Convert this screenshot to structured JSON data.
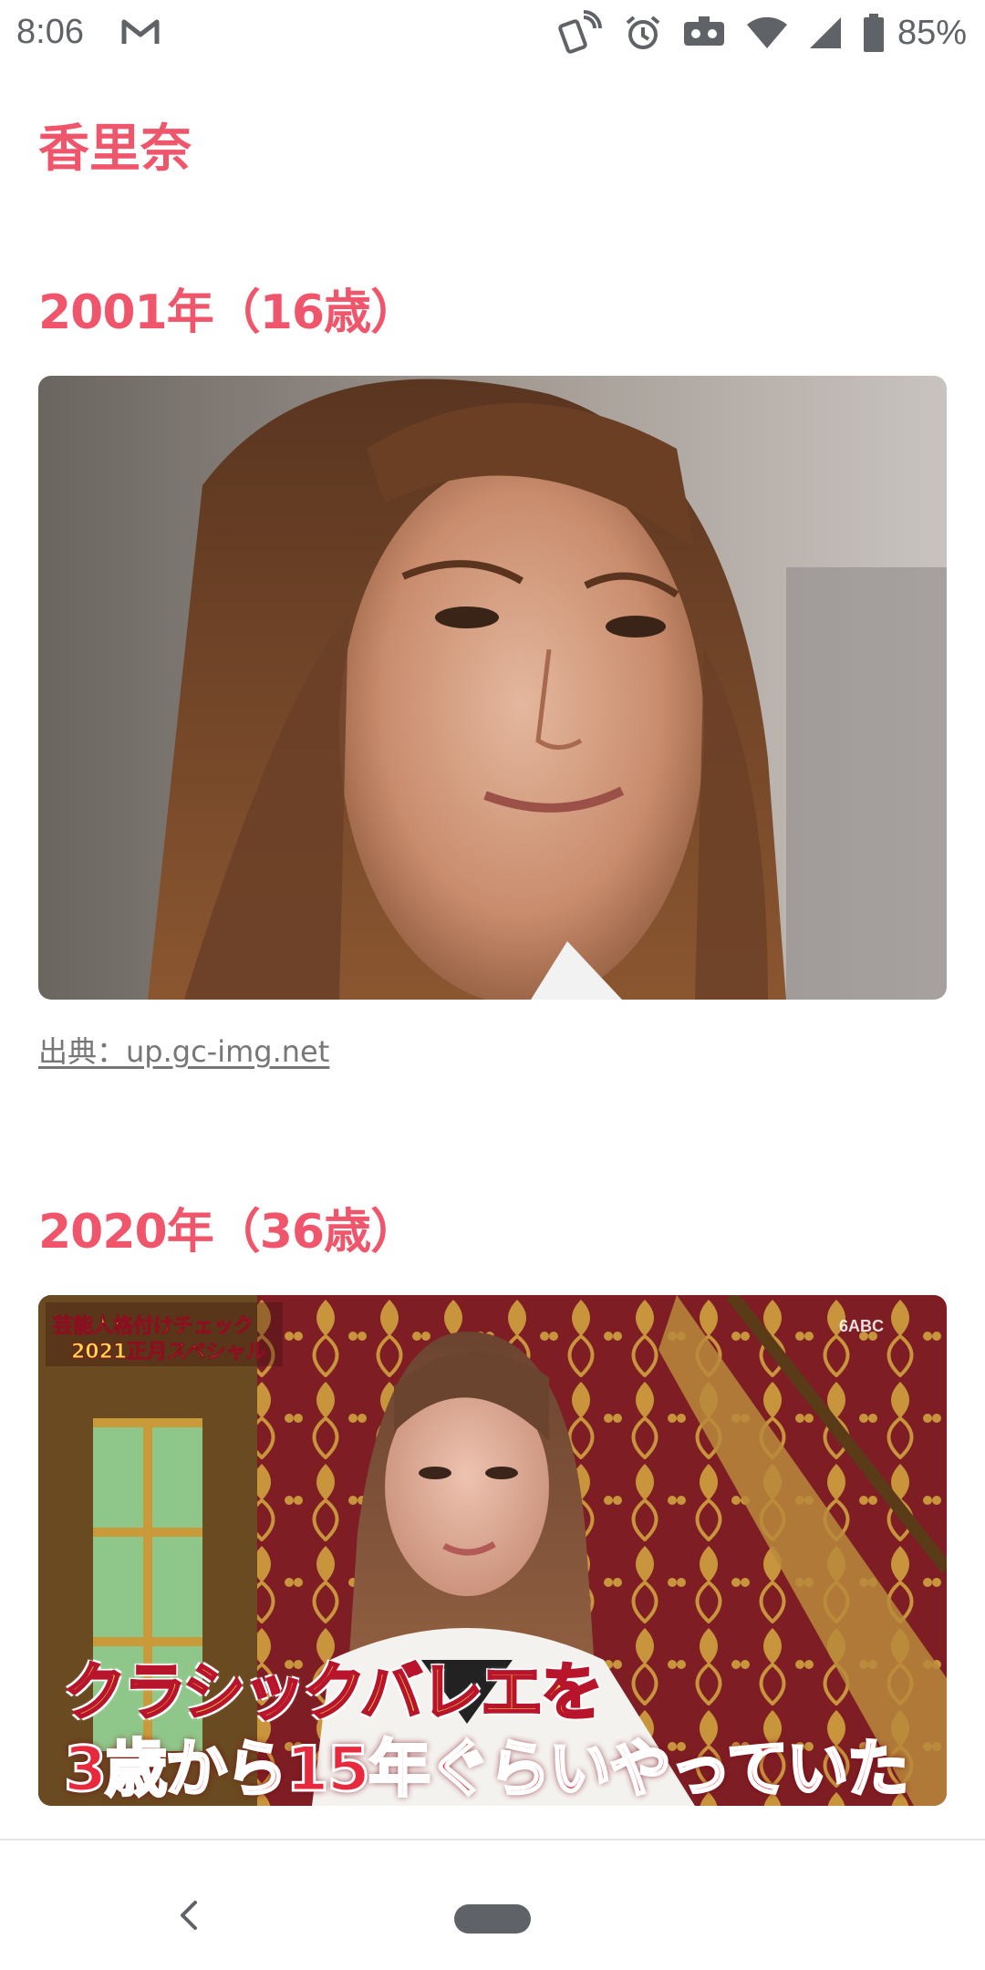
{
  "status_bar": {
    "time": "8:06",
    "battery_percent": "85%",
    "icons": [
      "gmail-icon",
      "nfc-icon",
      "alarm-icon",
      "vr-icon",
      "wifi-icon",
      "signal-icon",
      "battery-icon"
    ]
  },
  "article": {
    "title": "香里奈",
    "sections": [
      {
        "heading": "2001年（16歳）",
        "caption": "出典：up.gc-img.net"
      },
      {
        "heading": "2020年（36歳）",
        "overlay_top_line1": "芸能人格付けチェック",
        "overlay_top_line2": "2021正月スペシャル",
        "overlay_channel": "6ABC",
        "overlay_caption_line1": "クラシックバレエを",
        "overlay_caption_line2": "3歳から15年ぐらいやっていた"
      }
    ]
  },
  "colors": {
    "accent": "#f0566b",
    "caption": "#777777",
    "status_icons": "#5f6368"
  },
  "nav": {
    "icons": [
      "back-icon",
      "home-pill"
    ]
  }
}
